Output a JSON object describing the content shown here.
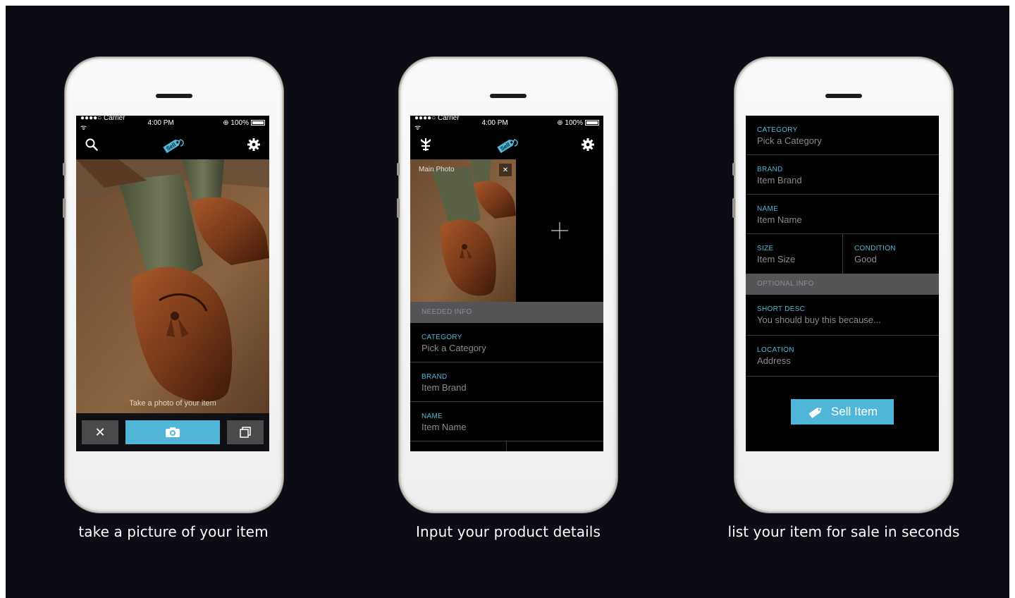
{
  "status_bar": {
    "signal": "●●●●○ Carrier ᯤ",
    "time": "4:00 PM",
    "battery": "⊕ 100%"
  },
  "logo_text": "Sell",
  "screen1": {
    "photo_hint": "Take a photo of your item"
  },
  "screen2": {
    "main_photo_label": "Main Photo",
    "section_needed": "NEEDED INFO",
    "fields": [
      {
        "label": "CATEGORY",
        "value": "Pick a Category"
      },
      {
        "label": "BRAND",
        "value": "Item Brand"
      },
      {
        "label": "NAME",
        "value": "Item Name"
      }
    ]
  },
  "screen3": {
    "fields": [
      {
        "label": "CATEGORY",
        "value": "Pick a Category"
      },
      {
        "label": "BRAND",
        "value": "Item Brand"
      },
      {
        "label": "NAME",
        "value": "Item Name"
      }
    ],
    "size": {
      "label": "SIZE",
      "value": "Item Size"
    },
    "condition": {
      "label": "CONDITION",
      "value": "Good"
    },
    "section_optional": "OPTIONAL INFO",
    "optional_fields": [
      {
        "label": "SHORT DESC",
        "value": "You should buy this because..."
      },
      {
        "label": "LOCATION",
        "value": "Address"
      }
    ],
    "sell_button": "Sell Item"
  },
  "captions": [
    "take a picture of your item",
    "Input your product details",
    "list your item for sale in seconds"
  ],
  "colors": {
    "accent": "#52b6d8",
    "background": "#0c0c14",
    "section": "#555558"
  },
  "icons": [
    "search-icon",
    "gear-icon",
    "sell-tag-icon",
    "close-icon",
    "camera-icon",
    "gallery-icon",
    "plus-icon",
    "hanger-icon"
  ]
}
